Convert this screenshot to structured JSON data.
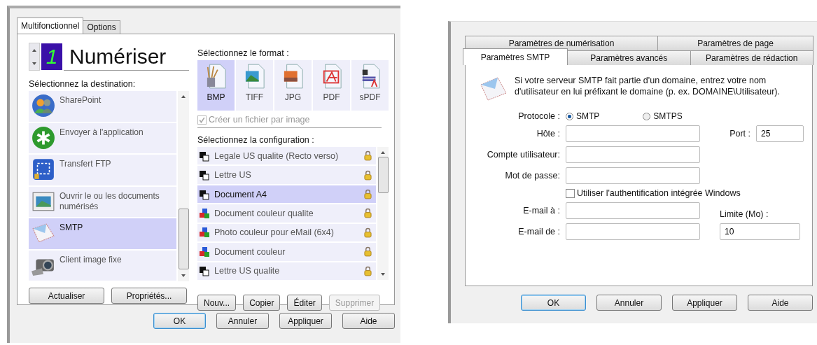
{
  "scan_dialog": {
    "tabs": [
      {
        "label": "Multifonctionnel",
        "selected": true
      },
      {
        "label": "Options",
        "selected": false
      }
    ],
    "job": {
      "number": "1",
      "title": "Numériser"
    },
    "destination_label": "Sélectionnez la destination:",
    "destinations": [
      {
        "label": "SharePoint",
        "selected": false
      },
      {
        "label": "Envoyer à l'application",
        "selected": false
      },
      {
        "label": "Transfert FTP",
        "selected": false
      },
      {
        "label": "Ouvrir le ou les documents numérisés",
        "selected": false
      },
      {
        "label": "SMTP",
        "selected": true
      },
      {
        "label": "Client image fixe",
        "selected": false
      }
    ],
    "destination_buttons": [
      "Actualiser",
      "Propriétés..."
    ],
    "format_label": "Sélectionnez le format :",
    "formats": [
      {
        "label": "BMP",
        "selected": true
      },
      {
        "label": "TIFF",
        "selected": false
      },
      {
        "label": "JPG",
        "selected": false
      },
      {
        "label": "PDF",
        "selected": false
      },
      {
        "label": "sPDF",
        "selected": false
      }
    ],
    "one_file_per_image": {
      "label": "Créer un fichier par image",
      "checked": true,
      "disabled": true
    },
    "configuration_label": "Sélectionnez la configuration :",
    "configurations": [
      {
        "label": "Legale US qualite (Recto verso)",
        "kind": "mono",
        "selected": false,
        "locked": true
      },
      {
        "label": "Lettre US",
        "kind": "mono",
        "selected": false,
        "locked": true
      },
      {
        "label": "Document A4",
        "kind": "mono",
        "selected": true,
        "locked": true
      },
      {
        "label": "Document couleur qualite",
        "kind": "color",
        "selected": false,
        "locked": true
      },
      {
        "label": "Photo couleur pour eMail (6x4)",
        "kind": "color",
        "selected": false,
        "locked": true
      },
      {
        "label": "Document couleur",
        "kind": "color",
        "selected": false,
        "locked": true
      },
      {
        "label": "Lettre US qualite",
        "kind": "mono",
        "selected": false,
        "locked": true
      }
    ],
    "configuration_buttons": [
      {
        "label": "Nouv...",
        "disabled": false
      },
      {
        "label": "Copier",
        "disabled": false
      },
      {
        "label": "Éditer",
        "disabled": false
      },
      {
        "label": "Supprimer",
        "disabled": true
      }
    ],
    "footer_buttons": [
      {
        "label": "OK",
        "default": true
      },
      {
        "label": "Annuler",
        "default": false
      },
      {
        "label": "Appliquer",
        "default": false
      },
      {
        "label": "Aide",
        "default": false
      }
    ]
  },
  "smtp_dialog": {
    "tab_rows": [
      [
        {
          "label": "Paramètres de numérisation",
          "selected": false
        },
        {
          "label": "Paramètres de page",
          "selected": false
        }
      ],
      [
        {
          "label": "Paramètres SMTP",
          "selected": true
        },
        {
          "label": "Paramètres avancés",
          "selected": false
        },
        {
          "label": "Paramètres de rédaction",
          "selected": false
        }
      ]
    ],
    "message": "Si votre serveur SMTP fait partie d'un domaine, entrez votre nom d'utilisateur en lui préfixant le domaine (p. ex. DOMAINE\\Utilisateur).",
    "protocol": {
      "label": "Protocole :",
      "options": [
        {
          "label": "SMTP",
          "selected": true
        },
        {
          "label": "SMTPS",
          "selected": false
        }
      ]
    },
    "host": {
      "label": "Hôte :"
    },
    "port": {
      "label": "Port :",
      "value": "25"
    },
    "account": {
      "label": "Compte utilisateur:"
    },
    "password": {
      "label": "Mot de passe:"
    },
    "windows_auth": {
      "label": "Utiliser l'authentification intégrée Windows",
      "checked": false
    },
    "email_to": {
      "label": "E-mail à :"
    },
    "email_from": {
      "label": "E-mail de :"
    },
    "limit": {
      "label": "Limite (Mo) :",
      "value": "10"
    },
    "footer_buttons": [
      {
        "label": "OK",
        "default": true
      },
      {
        "label": "Annuler",
        "default": false
      },
      {
        "label": "Appliquer",
        "default": false
      },
      {
        "label": "Aide",
        "default": false
      }
    ]
  }
}
